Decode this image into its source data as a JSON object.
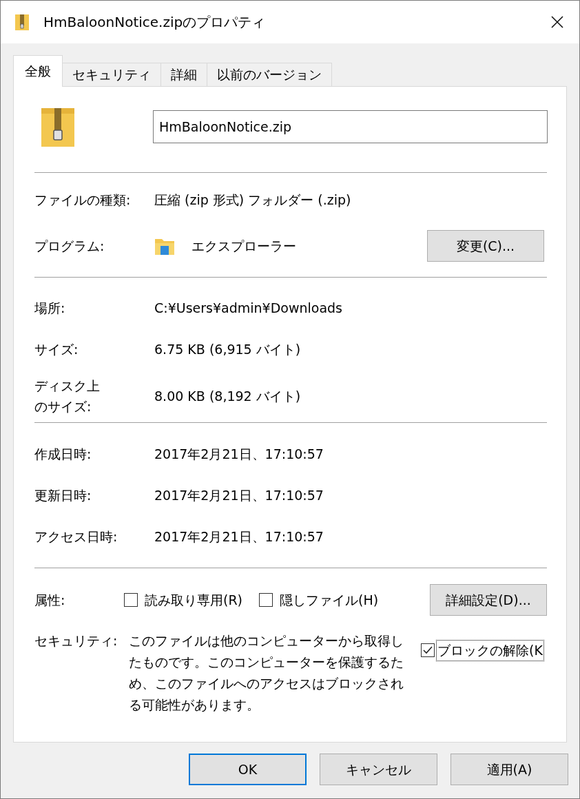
{
  "window": {
    "title": "HmBaloonNotice.zipのプロパティ"
  },
  "tabs": [
    {
      "label": "全般",
      "selected": true
    },
    {
      "label": "セキュリティ",
      "selected": false
    },
    {
      "label": "詳細",
      "selected": false
    },
    {
      "label": "以前のバージョン",
      "selected": false
    }
  ],
  "file_name": {
    "value": "HmBaloonNotice.zip"
  },
  "type": {
    "label": "ファイルの種類:",
    "value": "圧縮 (zip 形式) フォルダー (.zip)"
  },
  "program": {
    "label": "プログラム:",
    "value": "エクスプローラー",
    "button": "変更(C)..."
  },
  "location_rows": [
    {
      "label": "場所:",
      "value": "C:¥Users¥admin¥Downloads"
    },
    {
      "label": "サイズ:",
      "value": "6.75 KB (6,915 バイト)"
    },
    {
      "label": "ディスク上のサイズ:",
      "value": "8.00 KB (8,192 バイト)"
    }
  ],
  "date_rows": [
    {
      "label": "作成日時:",
      "value": "2017年2月21日、17:10:57"
    },
    {
      "label": "更新日時:",
      "value": "2017年2月21日、17:10:57"
    },
    {
      "label": "アクセス日時:",
      "value": "2017年2月21日、17:10:57"
    }
  ],
  "attributes": {
    "label": "属性:",
    "checkboxes": [
      {
        "label": "読み取り専用(R)",
        "checked": false
      },
      {
        "label": "隠しファイル(H)",
        "checked": false
      }
    ],
    "button": "詳細設定(D)..."
  },
  "security": {
    "label": "セキュリティ:",
    "text": "このファイルは他のコンピューターから取得したものです。このコンピューターを保護するため、このファイルへのアクセスはブロックされる可能性があります。",
    "checkbox": {
      "label": "ブロックの解除(K",
      "checked": true,
      "focused": true
    }
  },
  "buttons": [
    {
      "label": "OK",
      "default": true
    },
    {
      "label": "キャンセル",
      "default": false
    },
    {
      "label": "適用(A)",
      "default": false
    }
  ]
}
